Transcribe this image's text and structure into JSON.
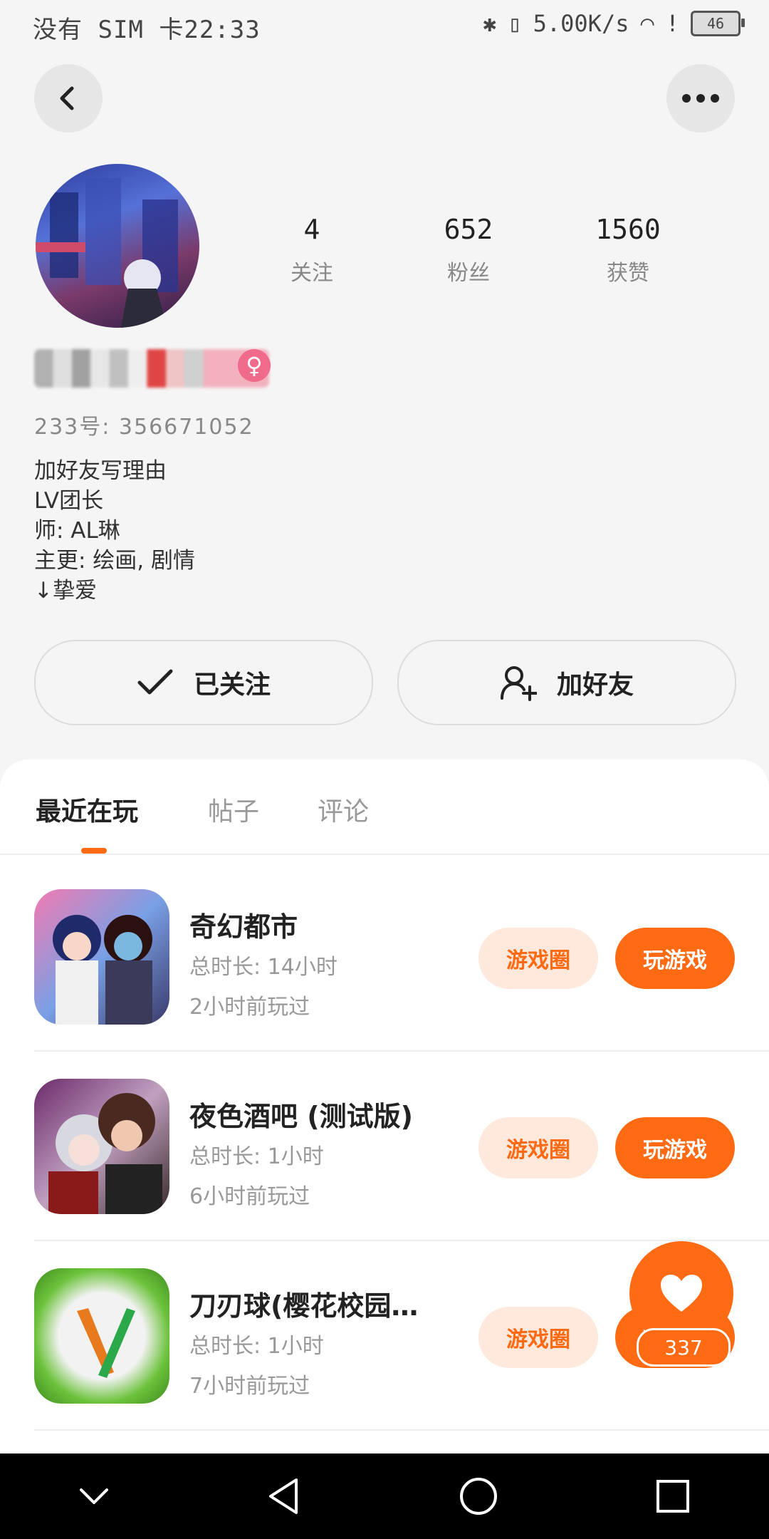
{
  "status": {
    "carrier_time": "没有 SIM 卡22:33",
    "speed": "5.00K/s",
    "battery": "46"
  },
  "profile": {
    "stats": [
      {
        "num": "4",
        "label": "关注"
      },
      {
        "num": "652",
        "label": "粉丝"
      },
      {
        "num": "1560",
        "label": "获赞"
      }
    ],
    "uid": "233号: 356671052",
    "bio": [
      "加好友写理由",
      "LV团长",
      "师: AL琳",
      "主更: 绘画, 剧情",
      "↓挚爱"
    ],
    "follow_label": "已关注",
    "add_friend_label": "加好友"
  },
  "tabs": [
    "最近在玩",
    "帖子",
    "评论"
  ],
  "games": [
    {
      "title": "奇幻都市",
      "total": "总时长: 14小时",
      "last": "2小时前玩过",
      "circle": "游戏圈",
      "play": "玩游戏"
    },
    {
      "title": "夜色酒吧 (测试版)",
      "total": "总时长: 1小时",
      "last": "6小时前玩过",
      "circle": "游戏圈",
      "play": "玩游戏"
    },
    {
      "title": "刀刃球(樱花校园…",
      "total": "总时长: 1小时",
      "last": "7小时前玩过",
      "circle": "游戏圈",
      "play": "玩游戏"
    }
  ],
  "like_count": "337",
  "colors": {
    "accent": "#ff6a13",
    "accent_light": "#ffe8dc"
  }
}
